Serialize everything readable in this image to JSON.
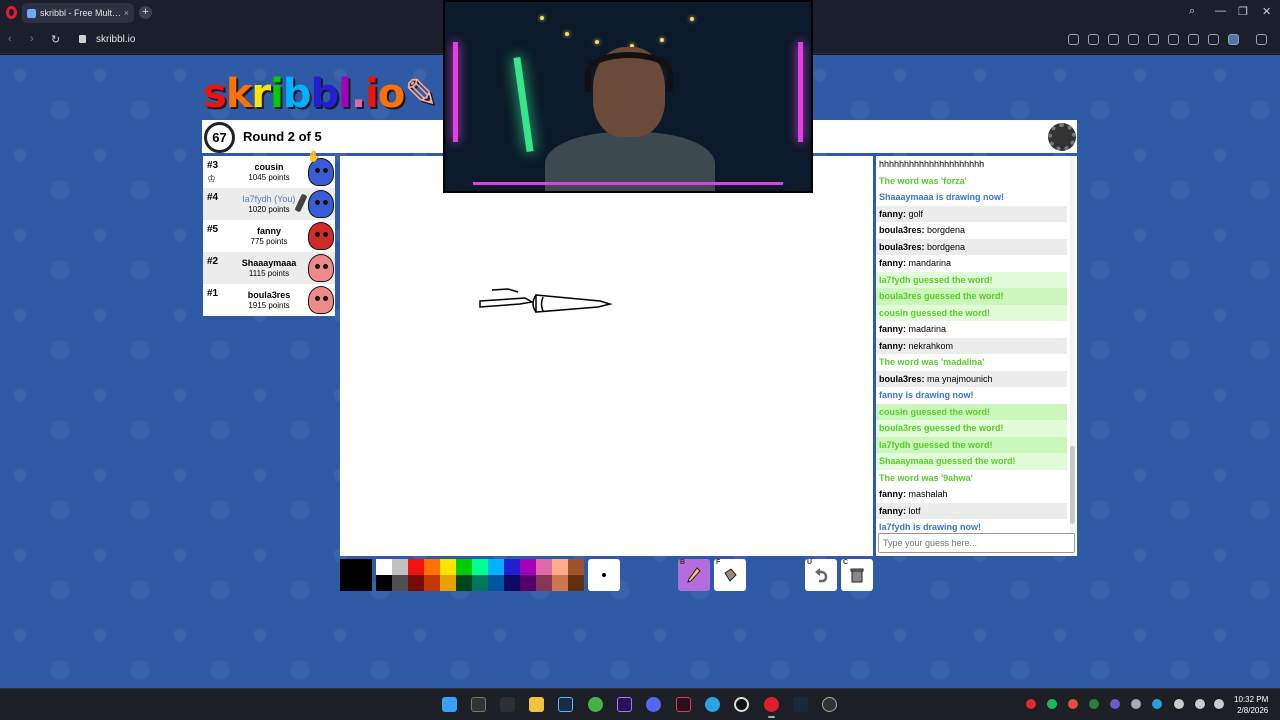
{
  "browser": {
    "tab_title": "skribbl - Free Multiplayer",
    "new_tab": "+",
    "close_tab": "×",
    "url": "skribbl.io",
    "window_controls": {
      "search": "⌕",
      "minimize": "—",
      "maximize": "❐",
      "close": "✕"
    }
  },
  "game": {
    "logo": "skribbl.io",
    "timer": "67",
    "round_label": "Round 2 of 5",
    "players": [
      {
        "rank": "#3",
        "name": "cousin",
        "points": "1045 points",
        "color": "#3a5bd6",
        "you": false,
        "crown": true
      },
      {
        "rank": "#4",
        "name": "la7fydh (You)",
        "points": "1020 points",
        "color": "#3a5bd6",
        "you": true,
        "drawing": true
      },
      {
        "rank": "#5",
        "name": "fanny",
        "points": "775 points",
        "color": "#cf2b2b",
        "you": false
      },
      {
        "rank": "#2",
        "name": "Shaaaymaaa",
        "points": "1115 points",
        "color": "#f08a8a",
        "you": false
      },
      {
        "rank": "#1",
        "name": "boula3res",
        "points": "1915 points",
        "color": "#f08a8a",
        "you": false
      }
    ],
    "chat": [
      {
        "type": "plain",
        "text": "hhhhhhhhhhhhhhhhhhhhh"
      },
      {
        "type": "sys-green",
        "text": "The word was 'forza'"
      },
      {
        "type": "sys-blue",
        "text": "Shaaaymaaa is drawing now!"
      },
      {
        "type": "msg",
        "user": "fanny:",
        "text": " golf"
      },
      {
        "type": "msg",
        "user": "boula3res:",
        "text": " borgdena"
      },
      {
        "type": "msg",
        "user": "boula3res:",
        "text": " bordgena"
      },
      {
        "type": "msg",
        "user": "fanny:",
        "text": " mandarina"
      },
      {
        "type": "guess",
        "text": "la7fydh guessed the word!"
      },
      {
        "type": "guess",
        "text": "boula3res guessed the word!"
      },
      {
        "type": "guess",
        "text": "cousin guessed the word!"
      },
      {
        "type": "msg",
        "user": "fanny:",
        "text": " madarina"
      },
      {
        "type": "msg",
        "user": "fanny:",
        "text": " nekrahkom"
      },
      {
        "type": "sys-green",
        "text": "The word was 'madalina'"
      },
      {
        "type": "msg",
        "user": "boula3res:",
        "text": " ma ynajmounich"
      },
      {
        "type": "sys-blue",
        "text": "fanny is drawing now!"
      },
      {
        "type": "guess",
        "text": "cousin guessed the word!"
      },
      {
        "type": "guess",
        "text": "boula3res guessed the word!"
      },
      {
        "type": "guess",
        "text": "la7fydh guessed the word!"
      },
      {
        "type": "guess",
        "text": "Shaaaymaaa guessed the word!"
      },
      {
        "type": "sys-green",
        "text": "The word was '9ahwa'"
      },
      {
        "type": "msg",
        "user": "fanny:",
        "text": " mashalah"
      },
      {
        "type": "msg",
        "user": "fanny:",
        "text": " lotf"
      },
      {
        "type": "sys-blue",
        "text": "la7fydh is drawing now!"
      }
    ],
    "guess_placeholder": "Type your guess here...",
    "palette": [
      "#ffffff",
      "#c1c1c1",
      "#ef130b",
      "#ff7100",
      "#ffe400",
      "#00cc00",
      "#00ff91",
      "#00b2ff",
      "#231fd3",
      "#a300ba",
      "#df69a7",
      "#ffac8e",
      "#a0522d",
      "#000000",
      "#505050",
      "#740b07",
      "#c23800",
      "#e8a200",
      "#004619",
      "#00785d",
      "#00569e",
      "#0e0865",
      "#550069",
      "#873554",
      "#cc774d",
      "#63300d"
    ],
    "current_color": "#000000",
    "tools": {
      "brush_key": "B",
      "fill_key": "F",
      "undo_key": "U",
      "clear_key": "C"
    }
  },
  "taskbar": {
    "time": "10:32 PM",
    "date": "2/8/2026"
  }
}
